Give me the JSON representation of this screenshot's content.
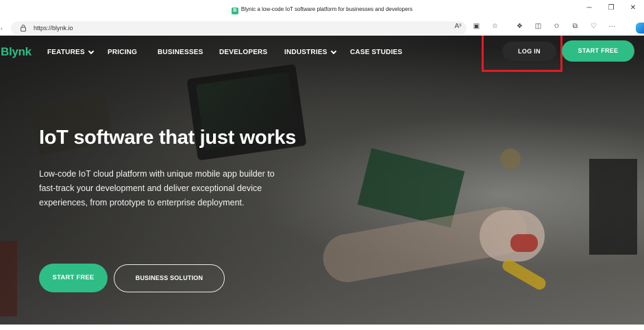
{
  "browser": {
    "tab_title": "Blynic a low-code IoT software platform for businesses and developers",
    "favicon_letter": "B",
    "url": "https://blynk.io",
    "window_controls": [
      "─",
      "❐",
      "✕"
    ],
    "url_icons": [
      "read-aloud-icon",
      "immersive-reader-icon",
      "favorite-star-icon"
    ],
    "toolbar_icons": [
      "extensions-icon",
      "split-screen-icon",
      "favorites-icon",
      "collections-icon",
      "browser-essentials-icon",
      "more-icon"
    ]
  },
  "site": {
    "logo": "Blynk",
    "brand_color": "#2ebd85",
    "nav": [
      {
        "label": "FEATURES",
        "has_dropdown": true
      },
      {
        "label": "PRICING",
        "has_dropdown": false
      },
      {
        "label": "BUSINESSES",
        "has_dropdown": false
      },
      {
        "label": "DEVELOPERS",
        "has_dropdown": false
      },
      {
        "label": "INDUSTRIES",
        "has_dropdown": true
      },
      {
        "label": "CASE STUDIES",
        "has_dropdown": false
      }
    ],
    "login_label": "LOG IN",
    "start_free_label": "START FREE",
    "highlight_color": "#e31b23"
  },
  "hero": {
    "headline": "IoT software that just works",
    "subtext": "Low-code IoT cloud platform with unique mobile app builder to fast-track your development and deliver exceptional device experiences, from prototype to enterprise deployment.",
    "primary_cta": "START FREE",
    "secondary_cta": "BUSINESS SOLUTION"
  }
}
